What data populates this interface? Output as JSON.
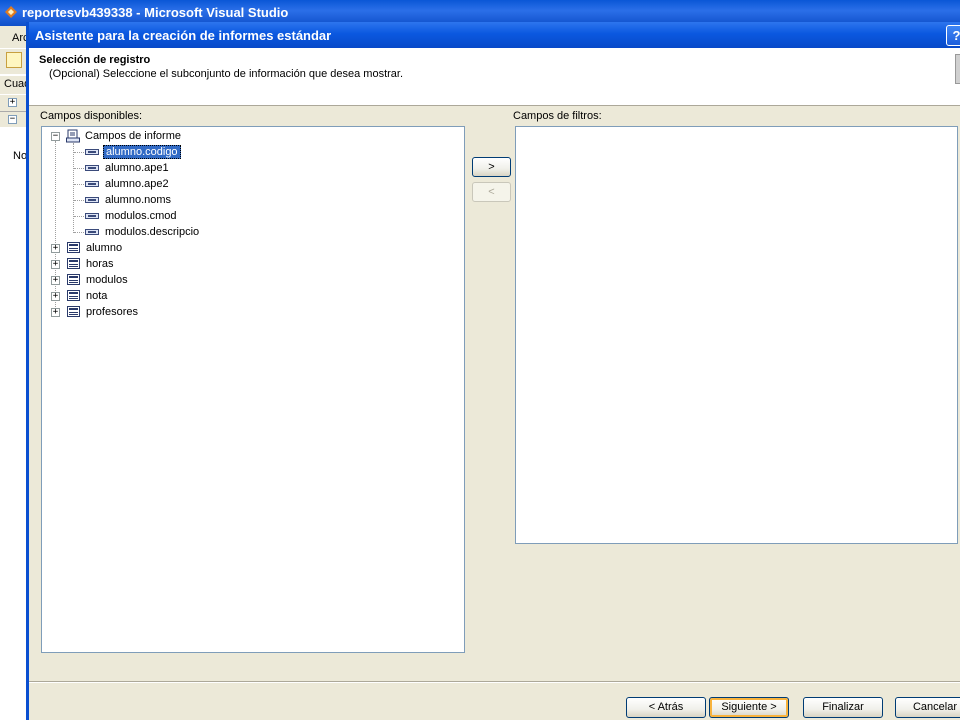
{
  "background_window": {
    "title": "reportesvb439338 - Microsoft Visual Studio",
    "menu_fragment": "Arc",
    "panel_header": "Cuad",
    "panel_text": "No"
  },
  "dialog": {
    "title": "Asistente para la creación de informes estándar",
    "help_label": "?",
    "header": {
      "title": "Selección de registro",
      "subtitle": "(Opcional) Seleccione el subconjunto de información que desea mostrar."
    },
    "available_label": "Campos disponibles:",
    "filters_label": "Campos de filtros:",
    "tree": {
      "root": {
        "label": "Campos de informe",
        "expander": "−"
      },
      "fields": [
        "alumno.codigo",
        "alumno.ape1",
        "alumno.ape2",
        "alumno.noms",
        "modulos.cmod",
        "modulos.descripcio"
      ],
      "selected_field": "alumno.codigo",
      "tables": [
        {
          "label": "alumno",
          "expander": "+"
        },
        {
          "label": "horas",
          "expander": "+"
        },
        {
          "label": "modulos",
          "expander": "+"
        },
        {
          "label": "nota",
          "expander": "+"
        },
        {
          "label": "profesores",
          "expander": "+"
        }
      ]
    },
    "add_button": ">",
    "remove_button": "<",
    "filter_items": [],
    "footer": {
      "back": "< Atrás",
      "next": "Siguiente >",
      "finish": "Finalizar",
      "cancel": "Cancelar"
    }
  },
  "colors": {
    "titlebar_blue": "#0a58e0",
    "selection": "#316ac5",
    "dialog_bg": "#ece9d8",
    "border": "#7f9db9"
  }
}
